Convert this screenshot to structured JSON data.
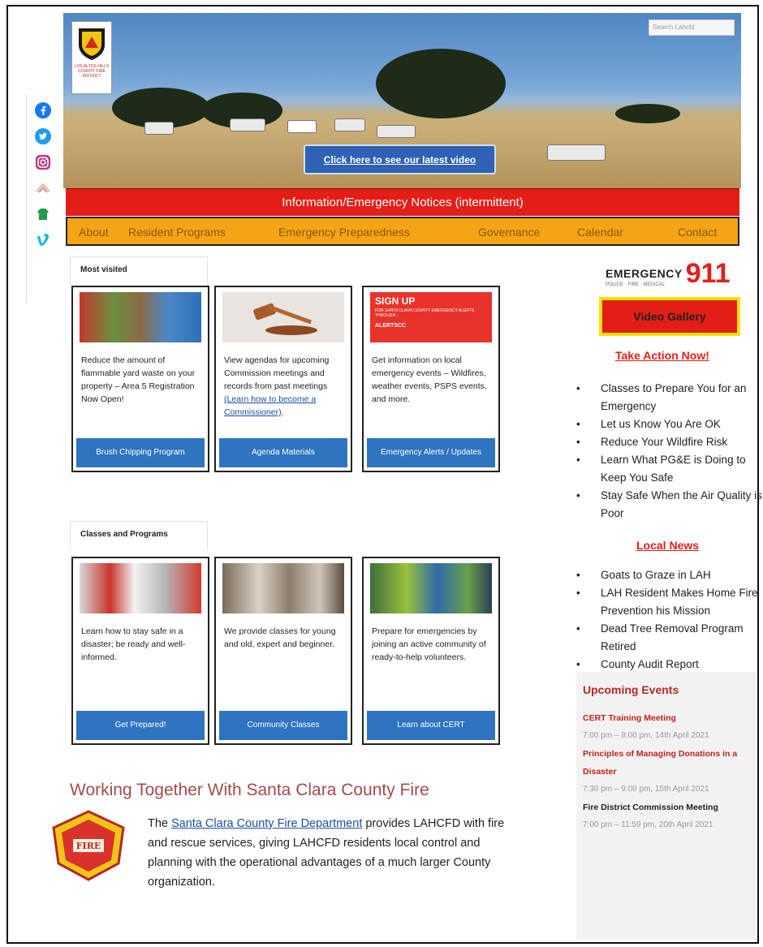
{
  "search": {
    "placeholder": "Search Lahcfd"
  },
  "hero": {
    "video_button": "Click here to see our latest video"
  },
  "notice": {
    "text": "Information/Emergency Notices (intermittent)"
  },
  "nav": [
    "About",
    "Resident Programs",
    "Emergency Preparedness",
    "Governance",
    "Calendar",
    "Contact"
  ],
  "social": [
    "facebook-icon",
    "twitter-icon",
    "instagram-icon",
    "nextdoor-icon",
    "website-icon",
    "vimeo-icon"
  ],
  "most_visited": {
    "title": "Most visited",
    "cards": [
      {
        "text": "Reduce the amount of flammable yard waste on your property – Area 5 Registration Now Open!",
        "button": "Brush Chipping Program"
      },
      {
        "text_before": "View agendas for upcoming Commission meetings and records from past meetings ",
        "link": "(Learn how to become a Commissioner)",
        "text_after": ".",
        "button": "Agenda Materials"
      },
      {
        "banner_title": "SIGN UP",
        "banner_sub": "FOR SANTA CLARA COUNTY EMERGENCY ALERTS THROUGH...",
        "banner_brand": "ALERTSCC",
        "text": "Get information on local emergency events – Wildfires, weather events, PSPS events, and more.",
        "button": "Emergency Alerts / Updates"
      }
    ]
  },
  "classes": {
    "title": "Classes and Programs",
    "cards": [
      {
        "text": "Learn how to stay safe in a disaster; be ready and well-informed.",
        "button": "Get Prepared!"
      },
      {
        "text": "We provide classes for young and old, expert and beginner.",
        "button": "Community Classes"
      },
      {
        "text": "Prepare for emergencies by joining an active community of ready-to-help volunteers.",
        "button": "Learn about CERT"
      }
    ]
  },
  "fire": {
    "heading": "Working Together With Santa Clara County Fire",
    "text_before": "The ",
    "link": "Santa Clara County Fire Department",
    "text_after": " provides LAHCFD with fire and rescue services, giving LAHCFD residents local control and planning with the operational advantages of a much larger County organization."
  },
  "sidebar": {
    "emergency_word": "EMERGENCY",
    "emergency_number": "911",
    "emergency_sub": "POLICE · FIRE · MEDICAL",
    "video_gallery": "Video Gallery",
    "take_action_title": "Take Action Now!",
    "take_action": [
      "Classes to Prepare You for an Emergency",
      "Let us Know You Are OK",
      "Reduce Your Wildfire Risk",
      "Learn What PG&E is Doing to Keep You Safe",
      "Stay Safe When the Air Quality is Poor"
    ],
    "local_news_title": "Local News",
    "local_news": [
      "Goats to Graze in LAH",
      "LAH Resident Makes Home Fire Prevention his Mission",
      "Dead Tree Removal Program Retired",
      "County Audit Report"
    ],
    "events_title": "Upcoming Events",
    "events": [
      {
        "title": "CERT Training Meeting",
        "when": "7:00 pm – 8:00 pm, 14th April 2021",
        "red": true
      },
      {
        "title": "Principles of Managing Donations in a Disaster",
        "when": "7:30 pm – 9:00 pm, 15th April 2021",
        "red": true
      },
      {
        "title": "Fire District Commission Meeting",
        "when": "7:00 pm – 11:59 pm, 20th April 2021",
        "red": false
      }
    ]
  },
  "colors": {
    "notice_red": "#e31e17",
    "nav_orange": "#f4a414",
    "cta_blue": "#2f74bf",
    "heading_red": "#a34b48"
  }
}
